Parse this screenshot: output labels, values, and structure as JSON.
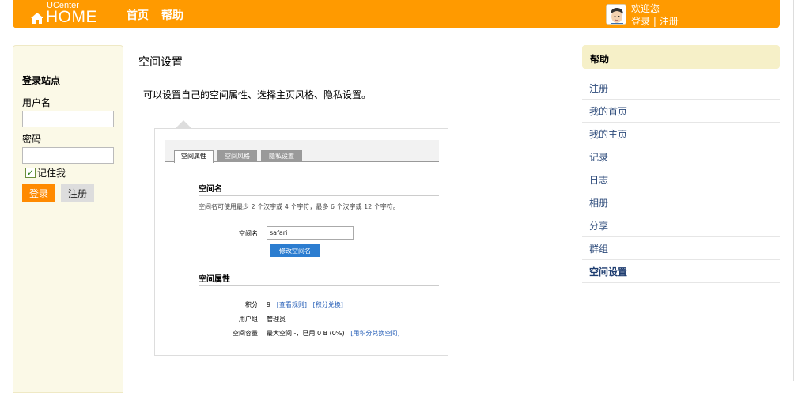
{
  "header": {
    "logo_small": "UCenter",
    "logo_big": "HOME",
    "nav": [
      "首页",
      "帮助"
    ],
    "welcome": "欢迎您",
    "login_link": "登录",
    "separator": "|",
    "register_link": "注册"
  },
  "login": {
    "title": "登录站点",
    "username_label": "用户名",
    "username_value": "",
    "password_label": "密码",
    "password_value": "",
    "remember_label": "记住我",
    "remember_checked": true,
    "login_button": "登录",
    "register_button": "注册"
  },
  "main": {
    "title": "空间设置",
    "intro": "可以设置自己的空间属性、选择主页风格、隐私设置。"
  },
  "preview": {
    "tabs": [
      "空间属性",
      "空间风格",
      "隐私设置"
    ],
    "active_tab": "空间属性",
    "space_name_section": "空间名",
    "space_name_note": "空间名可使用最少 2 个汉字或 4 个字符，最多 6 个汉字或 12 个字符。",
    "space_name_label": "空间名",
    "space_name_value": "safari",
    "rename_button": "修改空间名",
    "attributes_section": "空间属性",
    "points_label": "积分",
    "points_value": "9",
    "view_rules_link": "[查看规则]",
    "exchange_link": "[积分兑换]",
    "group_label": "用户组",
    "group_value": "管理员",
    "capacity_label": "空间容量",
    "capacity_value": "最大空间 -，已用 0 B (0%)",
    "capacity_link": "[用积分兑换空间]"
  },
  "help": {
    "title": "帮助",
    "items": [
      "注册",
      "我的首页",
      "我的主页",
      "记录",
      "日志",
      "相册",
      "分享",
      "群组",
      "空间设置"
    ],
    "current": "空间设置"
  },
  "colors": {
    "header_bg": "#ff9a00",
    "sidebar_bg": "#fbf9e7",
    "help_head_bg": "#f6f0c8",
    "link": "#2c4a7a",
    "button_blue": "#2c7dd0"
  }
}
